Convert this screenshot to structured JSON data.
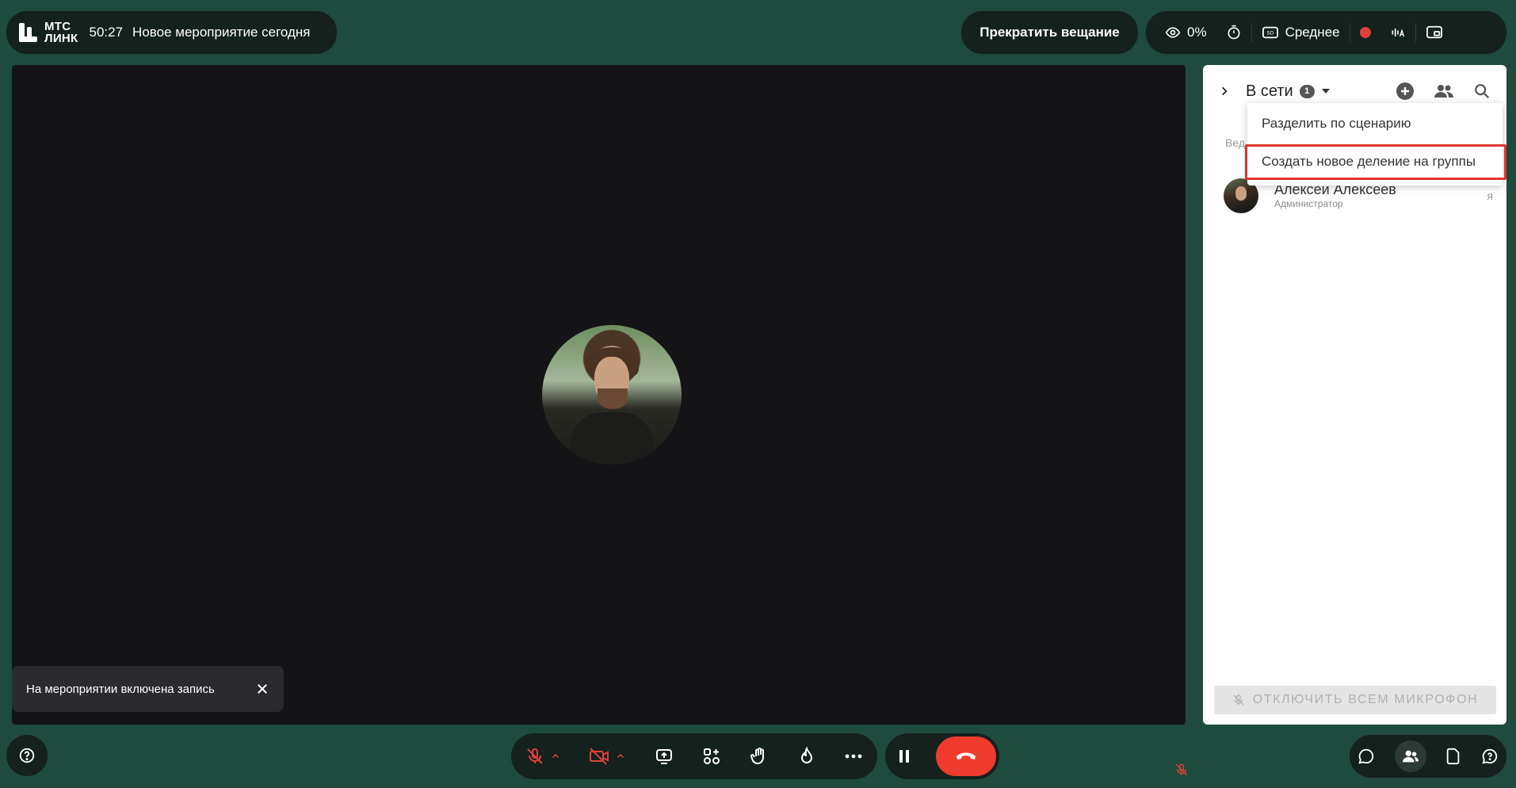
{
  "header": {
    "logo_line1": "МТС",
    "logo_line2": "ЛИНК",
    "timer": "50:27",
    "event_title": "Новое мероприятие сегодня",
    "stop_broadcast_label": "Прекратить вещание",
    "viewers_percent": "0%",
    "quality_label": "Среднее"
  },
  "stage": {
    "recording_toast": "На мероприятии включена запись"
  },
  "panel": {
    "title": "В сети",
    "online_count": "1",
    "section_label": "Вед",
    "participant": {
      "name": "Алексей Алексеев",
      "role": "Администратор",
      "me_marker": "я"
    },
    "mute_all_label": "ОТКЛЮЧИТЬ ВСЕМ МИКРОФОН"
  },
  "dropdown": {
    "items": [
      {
        "label": "Разделить по сценарию"
      },
      {
        "label": "Создать новое деление на группы"
      }
    ]
  },
  "colors": {
    "background": "#1f4a3e",
    "bar": "#14211d",
    "stage": "#141416",
    "hangup": "#ef3b2d",
    "recording": "#e23e3e",
    "muted": "#e0423a",
    "highlight": "#e2342f"
  },
  "icons": [
    "eye-icon",
    "stopwatch-icon",
    "quality-icon",
    "record-dot-icon",
    "audio-captions-icon",
    "layout-icon",
    "chevron-right-icon",
    "caret-down-icon",
    "add-circle-icon",
    "people-icon",
    "search-icon",
    "close-icon",
    "mic-off-icon",
    "camera-off-icon",
    "chevron-up-icon",
    "share-screen-icon",
    "apps-icon",
    "hand-icon",
    "fire-icon",
    "more-icon",
    "pause-icon",
    "hangup-icon",
    "chat-icon",
    "participants-icon",
    "files-icon",
    "help-icon"
  ]
}
